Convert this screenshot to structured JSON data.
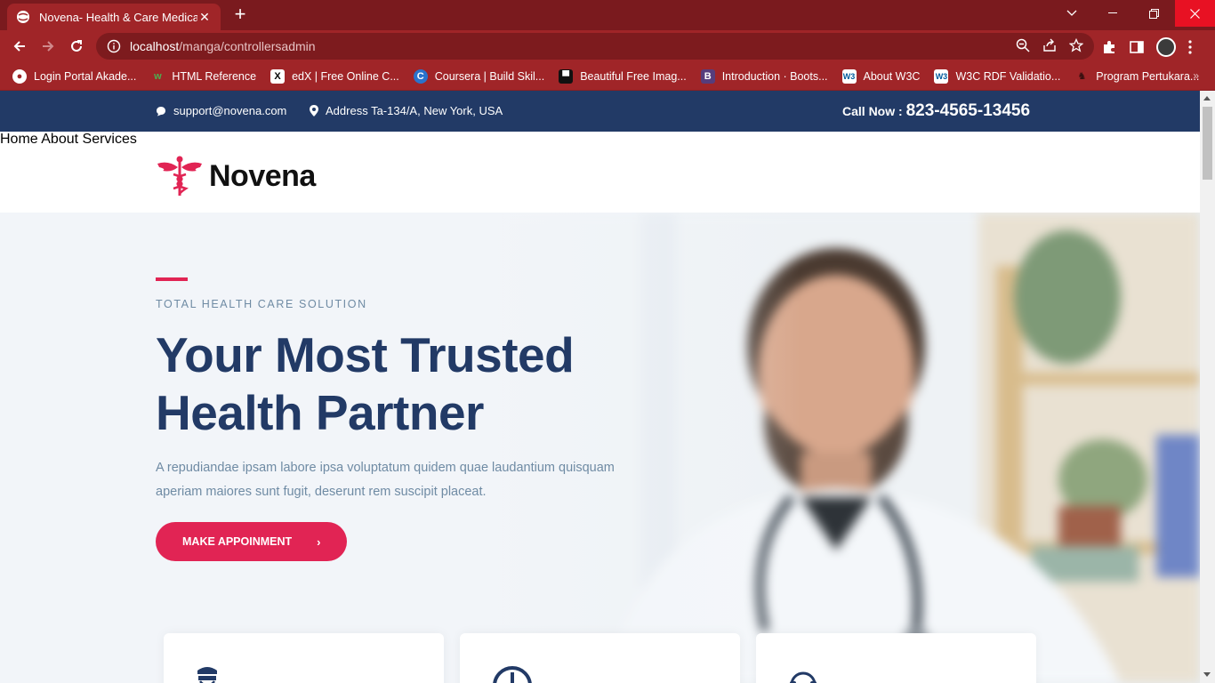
{
  "browser": {
    "tab_title": "Novena- Health & Care Medical t",
    "url_host": "localhost",
    "url_path": "/manga/controllersadmin",
    "bookmarks": [
      {
        "label": "Login Portal Akade...",
        "icon": "globe-icon"
      },
      {
        "label": "HTML Reference",
        "icon": "w3schools-icon"
      },
      {
        "label": "edX | Free Online C...",
        "icon": "edx-icon"
      },
      {
        "label": "Coursera | Build Skil...",
        "icon": "coursera-icon"
      },
      {
        "label": "Beautiful Free Imag...",
        "icon": "unsplash-icon"
      },
      {
        "label": "Introduction · Boots...",
        "icon": "bootstrap-icon"
      },
      {
        "label": "About W3C",
        "icon": "w3c-icon"
      },
      {
        "label": "W3C RDF Validatio...",
        "icon": "w3c-icon"
      },
      {
        "label": "Program Pertukara...",
        "icon": "program-icon"
      }
    ],
    "bookmarks_more": "»"
  },
  "topbar": {
    "email": "support@novena.com",
    "address": "Address Ta-134/A, New York, USA",
    "call_label": "Call Now : ",
    "call_number": "823-4565-13456"
  },
  "nav": {
    "logo_text": "Novena",
    "items": [
      "Home",
      "About",
      "Services"
    ]
  },
  "hero": {
    "tagline": "TOTAL HEALTH CARE SOLUTION",
    "headline_line1": "Your Most Trusted",
    "headline_line2": "Health Partner",
    "lede": "A repudiandae ipsam labore ipsa voluptatum quidem quae laudantium quisquam aperiam maiores sunt fugit, deserunt rem suscipit placeat.",
    "cta_label": "MAKE APPOINMENT",
    "cta_chevron": "›"
  },
  "colors": {
    "brand_navy": "#223a66",
    "brand_pink": "#e12454",
    "browser_red": "#a02528",
    "muted_text": "#6f8ba4"
  }
}
